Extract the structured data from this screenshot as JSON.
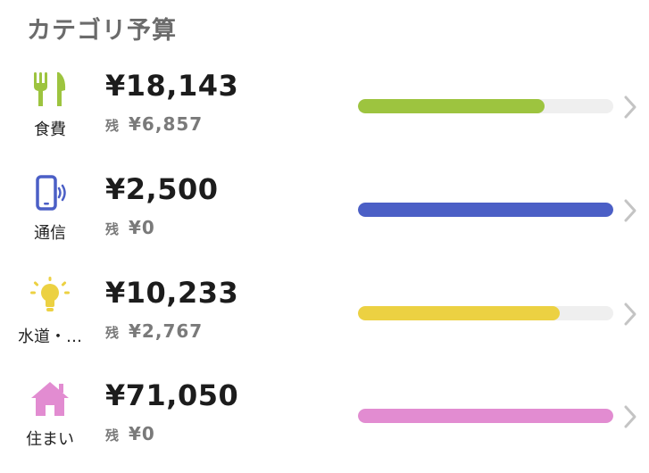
{
  "header": {
    "title": "カテゴリ予算"
  },
  "categories": [
    {
      "label": "食費",
      "icon": "fork-knife-icon",
      "spent": "¥18,143",
      "remain_prefix": "残",
      "remain_amount": "¥6,857",
      "progress": 0.73,
      "color": "#9dc43f"
    },
    {
      "label": "通信",
      "icon": "smartphone-icon",
      "spent": "¥2,500",
      "remain_prefix": "残",
      "remain_amount": "¥0",
      "progress": 1.0,
      "color": "#4b5fc6"
    },
    {
      "label": "水道・…",
      "icon": "lightbulb-icon",
      "spent": "¥10,233",
      "remain_prefix": "残",
      "remain_amount": "¥2,767",
      "progress": 0.79,
      "color": "#ecd142"
    },
    {
      "label": "住まい",
      "icon": "house-icon",
      "spent": "¥71,050",
      "remain_prefix": "残",
      "remain_amount": "¥0",
      "progress": 1.0,
      "color": "#e28cd1"
    }
  ]
}
